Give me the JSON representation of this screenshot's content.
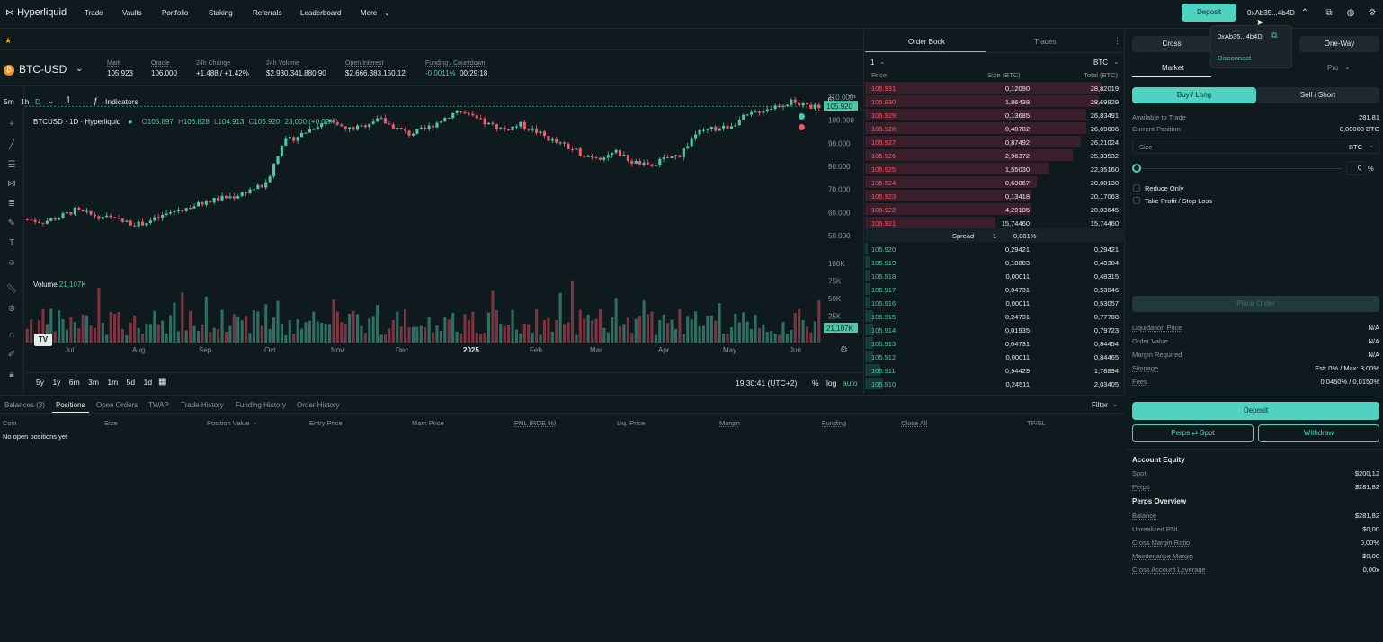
{
  "app": {
    "name": "Hyperliquid"
  },
  "nav": {
    "items": [
      "Trade",
      "Vaults",
      "Portfolio",
      "Staking",
      "Referrals",
      "Leaderboard",
      "More"
    ]
  },
  "header": {
    "deposit_label": "Deposit",
    "address": "0xAb35...4b4D"
  },
  "account_menu": {
    "address": "0xAb35...4b4D",
    "disconnect_label": "Disconnect"
  },
  "market": {
    "symbol": "BTC-USD",
    "stats": [
      {
        "label": "Mark",
        "value": "105.923"
      },
      {
        "label": "Oracle",
        "value": "106.000"
      },
      {
        "label": "24h Change",
        "value": "+1.488 / +1,42%"
      },
      {
        "label": "24h Volume",
        "value": "$2.930.341.880,90"
      },
      {
        "label": "Open Interest",
        "value": "$2.666.383.150,12"
      },
      {
        "label": "Funding / Countdown",
        "value": "-0,0011%",
        "countdown": "00:29:18"
      }
    ]
  },
  "chart_toolbar": {
    "intervals": [
      "5m",
      "1h",
      "D"
    ],
    "indicators_label": "Indicators"
  },
  "chart_legend": {
    "title": "BTCUSD · 1D · Hyperliquid",
    "o_label": "O",
    "o": "105.897",
    "h_label": "H",
    "h": "106.828",
    "l_label": "L",
    "l": "104.913",
    "c_label": "C",
    "c": "105.920",
    "change": "23,000 (+0,02%)",
    "volume_label": "Volume",
    "volume_value": "21,107K"
  },
  "chart_bottom": {
    "ranges": [
      "5y",
      "1y",
      "6m",
      "3m",
      "1m",
      "5d",
      "1d"
    ],
    "time": "19:30:41 (UTC+2)",
    "pct": "%",
    "log": "log",
    "auto": "auto"
  },
  "chart_data": {
    "type": "candlestick",
    "x_labels": [
      "Jul",
      "Aug",
      "Sep",
      "Oct",
      "Nov",
      "Dec",
      "2025",
      "Feb",
      "Mar",
      "Apr",
      "May",
      "Jun"
    ],
    "price_ticks": [
      "110.000",
      "100.000",
      "90.000",
      "80.000",
      "70.000",
      "60.000",
      "50.000"
    ],
    "volume_ticks": [
      "100K",
      "75K",
      "50K",
      "25K"
    ],
    "last_price": "105.920",
    "last_volume": "21,107K",
    "close": [
      57000,
      56000,
      58000,
      61000,
      59000,
      58000,
      56000,
      55000,
      57000,
      60000,
      62000,
      64000,
      66000,
      67000,
      70000,
      72000,
      90000,
      93000,
      97000,
      99000,
      96000,
      97000,
      101000,
      97000,
      94000,
      96000,
      100000,
      104000,
      101000,
      98000,
      96000,
      98000,
      95000,
      91000,
      88000,
      85000,
      84000,
      86000,
      82000,
      80000,
      83000,
      85000,
      94000,
      96000,
      97000,
      101000,
      104000,
      106000,
      108000,
      106000
    ]
  },
  "orderbook": {
    "tabs": [
      "Order Book",
      "Trades"
    ],
    "group": "1",
    "unit": "BTC",
    "headers": [
      "Price",
      "Size (BTC)",
      "Total (BTC)"
    ],
    "asks": [
      [
        "105.931",
        "0,12090",
        "28,82019"
      ],
      [
        "105.930",
        "1,86438",
        "28,69929"
      ],
      [
        "105.929",
        "0,13685",
        "26,83491"
      ],
      [
        "105.928",
        "0,48782",
        "26,69806"
      ],
      [
        "105.927",
        "0,87492",
        "26,21024"
      ],
      [
        "105.926",
        "2,96372",
        "25,33532"
      ],
      [
        "105.925",
        "1,55030",
        "22,35160"
      ],
      [
        "105.924",
        "0,63067",
        "20,80130"
      ],
      [
        "105.923",
        "0,13418",
        "20,17063"
      ],
      [
        "105.922",
        "4,29185",
        "20,03645"
      ],
      [
        "105.921",
        "15,74460",
        "15,74460"
      ]
    ],
    "spread_label": "Spread",
    "spread_value": "1",
    "spread_pct": "0,001%",
    "bids": [
      [
        "105.920",
        "0,29421",
        "0,29421"
      ],
      [
        "105.919",
        "0,18883",
        "0,48304"
      ],
      [
        "105.918",
        "0,00011",
        "0,48315"
      ],
      [
        "105.917",
        "0,04731",
        "0,53046"
      ],
      [
        "105.916",
        "0,00011",
        "0,53057"
      ],
      [
        "105.915",
        "0,24731",
        "0,77788"
      ],
      [
        "105.914",
        "0,01935",
        "0,79723"
      ],
      [
        "105.913",
        "0,04731",
        "0,84454"
      ],
      [
        "105.912",
        "0,00011",
        "0,84465"
      ],
      [
        "105.911",
        "0,94429",
        "1,78894"
      ],
      [
        "105.910",
        "0,24511",
        "2,03405"
      ]
    ],
    "ask_depth": [
      0.91,
      0.9,
      0.85,
      0.85,
      0.83,
      0.8,
      0.71,
      0.66,
      0.64,
      0.64,
      0.5
    ],
    "bid_depth": [
      0.01,
      0.02,
      0.02,
      0.02,
      0.02,
      0.03,
      0.03,
      0.03,
      0.03,
      0.06,
      0.07
    ]
  },
  "bottom_tabs": {
    "tabs": [
      "Balances (3)",
      "Positions",
      "Open Orders",
      "TWAP",
      "Trade History",
      "Funding History",
      "Order History"
    ],
    "filter_label": "Filter",
    "columns": [
      "Coin",
      "Size",
      "Position Value",
      "Entry Price",
      "Mark Price",
      "PNL (ROE %)",
      "Liq. Price",
      "Margin",
      "Funding",
      "Close All",
      "TP/SL"
    ],
    "empty_text": "No open positions yet"
  },
  "trade_panel": {
    "margin_mode": "Cross",
    "position_mode": "One-Way",
    "order_types": [
      "Market",
      "Pro"
    ],
    "sides": [
      "Buy / Long",
      "Sell / Short"
    ],
    "available_label": "Available to Trade",
    "available_value": "281,81",
    "position_label": "Current Position",
    "position_value": "0,00000 BTC",
    "size_label": "Size",
    "size_unit": "BTC",
    "slider_value": "0",
    "slider_unit": "%",
    "reduce_only": "Reduce Only",
    "tpsl": "Take Profit / Stop Loss",
    "place_order": "Place Order",
    "details": [
      {
        "k": "Liquidation Price",
        "v": "N/A"
      },
      {
        "k": "Order Value",
        "v": "N/A"
      },
      {
        "k": "Margin Required",
        "v": "N/A"
      },
      {
        "k": "Slippage",
        "v": "Est: 0% / Max: 8,00%"
      },
      {
        "k": "Fees",
        "v": "0,0450% / 0,0150%"
      }
    ],
    "deposit_label": "Deposit",
    "perps_spot_label": "Perps ⇄ Spot",
    "withdraw_label": "Withdraw",
    "equity_title": "Account Equity",
    "equity": [
      {
        "k": "Spot",
        "v": "$200,12"
      },
      {
        "k": "Perps",
        "v": "$281,82"
      }
    ],
    "overview_title": "Perps Overview",
    "overview": [
      {
        "k": "Balance",
        "v": "$281,82"
      },
      {
        "k": "Unrealized PNL",
        "v": "$0,00"
      },
      {
        "k": "Cross Margin Ratio",
        "v": "0,00%"
      },
      {
        "k": "Maintenance Margin",
        "v": "$0,00"
      },
      {
        "k": "Cross Account Leverage",
        "v": "0,00x"
      }
    ]
  },
  "colors": {
    "accent": "#50d2c1",
    "up": "#4fc6a6",
    "down": "#ee5a6a",
    "bg": "#0f1a1f"
  }
}
